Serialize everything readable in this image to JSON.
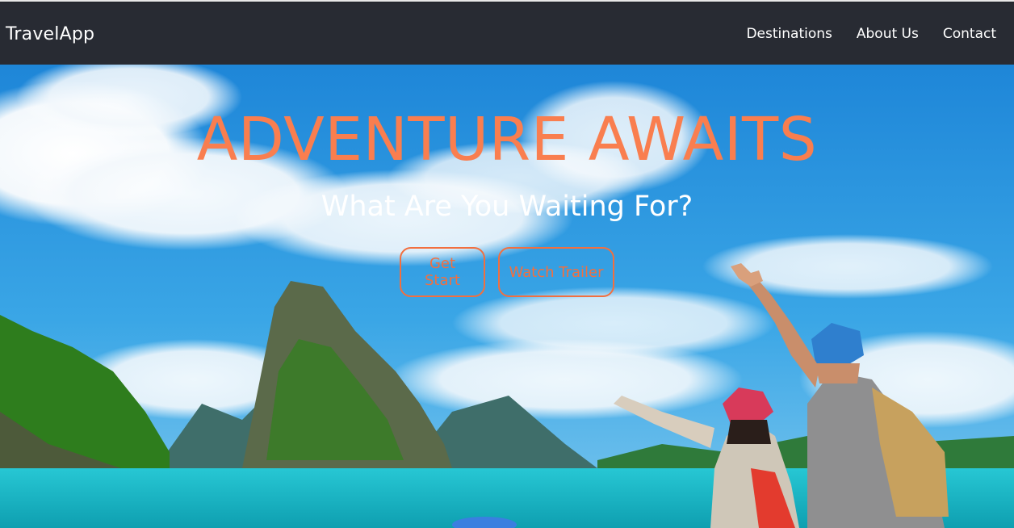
{
  "nav": {
    "brand": "TravelApp",
    "links": [
      "Destinations",
      "About Us",
      "Contact"
    ]
  },
  "hero": {
    "headline": "ADVENTURE AWAITS",
    "subheadline": "What Are You Waiting For?",
    "buttons": {
      "get_start": "Get Start",
      "watch_trailer": "Watch Trailer"
    }
  },
  "colors": {
    "navbar": "#282b33",
    "accent": "#f26f3f",
    "headline": "#f97e4f"
  }
}
